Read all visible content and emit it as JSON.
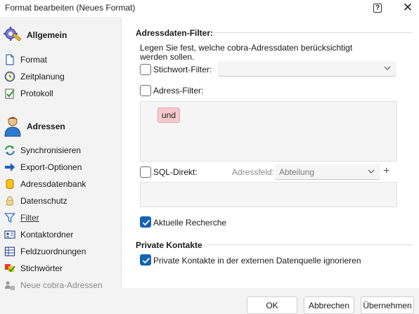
{
  "window": {
    "title": "Format bearbeiten (Neues Format)",
    "help_glyph": "?",
    "close_glyph": "✕"
  },
  "sidebar": {
    "sections": [
      {
        "title": "Allgemein",
        "icon": "gear-wrench-icon",
        "items": [
          {
            "label": "Format",
            "icon": "document-icon"
          },
          {
            "label": "Zeitplanung",
            "icon": "clock-icon"
          },
          {
            "label": "Protokoll",
            "icon": "log-check-icon"
          }
        ]
      },
      {
        "title": "Adressen",
        "icon": "person-icon",
        "items": [
          {
            "label": "Synchronisieren",
            "icon": "sync-icon"
          },
          {
            "label": "Export-Optionen",
            "icon": "arrow-right-icon"
          },
          {
            "label": "Adressdatenbank",
            "icon": "database-icon"
          },
          {
            "label": "Datenschutz",
            "icon": "lock-icon"
          },
          {
            "label": "Filter",
            "icon": "filter-icon",
            "active": true
          },
          {
            "label": "Kontaktordner",
            "icon": "contact-card-icon"
          },
          {
            "label": "Feldzuordnungen",
            "icon": "field-table-icon"
          },
          {
            "label": "Stichwörter",
            "icon": "keywords-icon"
          },
          {
            "label": "Neue cobra-Adressen",
            "icon": "new-addresses-icon",
            "disabled": true
          }
        ]
      }
    ]
  },
  "address_filter_group": {
    "title": "Adressdaten-Filter:",
    "description": "Legen Sie fest, welche cobra-Adressdaten berücksichtigt werden sollen.",
    "keyword_filter": {
      "label": "Stichwort-Filter:",
      "checked": false,
      "value": ""
    },
    "address_filter": {
      "label": "Adress-Filter:",
      "checked": false,
      "tag": "und"
    },
    "sql_direct": {
      "label": "SQL-Direkt:",
      "checked": false,
      "field_label": "Adressfeld:",
      "field_value": "Abteilung",
      "add_glyph": "+"
    },
    "current_research": {
      "label": "Aktuelle Recherche",
      "checked": true
    }
  },
  "private_contacts_group": {
    "title": "Private Kontakte",
    "ignore_private": {
      "label": "Private Kontakte in der externen Datenquelle ignorieren",
      "checked": true
    }
  },
  "footer": {
    "ok_label": "OK",
    "cancel_label": "Abbrechen",
    "apply_label": "Übernehmen"
  },
  "colors": {
    "accent": "#1464b4",
    "tag_bg": "#f8c9cc"
  }
}
